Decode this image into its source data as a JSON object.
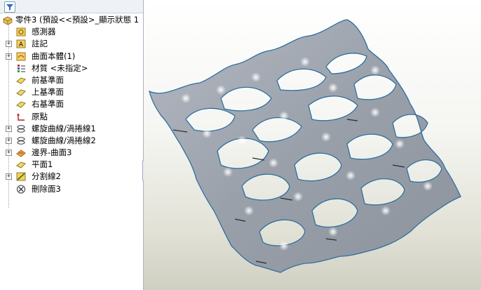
{
  "feature_tree": {
    "root_label": "零件3  (預設<<預設>_顯示狀態 1",
    "items": [
      {
        "label": "感測器",
        "icon": "sensor-icon",
        "expandable": false
      },
      {
        "label": "註記",
        "icon": "annotation-icon",
        "expandable": true
      },
      {
        "label": "曲面本體(1)",
        "icon": "surface-bodies-icon",
        "expandable": true
      },
      {
        "label": "材質 <未指定>",
        "icon": "material-icon",
        "expandable": false
      },
      {
        "label": "前基準面",
        "icon": "plane-icon",
        "expandable": false
      },
      {
        "label": "上基準面",
        "icon": "plane-icon",
        "expandable": false
      },
      {
        "label": "右基準面",
        "icon": "plane-icon",
        "expandable": false
      },
      {
        "label": "原點",
        "icon": "origin-icon",
        "expandable": false
      },
      {
        "label": "螺旋曲線/渦捲線1",
        "icon": "helix-icon",
        "expandable": true
      },
      {
        "label": "螺旋曲線/渦捲線2",
        "icon": "helix-icon",
        "expandable": true
      },
      {
        "label": "邊界-曲面3",
        "icon": "boundary-surface-icon",
        "expandable": true
      },
      {
        "label": "平面1",
        "icon": "plane-icon",
        "expandable": false
      },
      {
        "label": "分割線2",
        "icon": "split-line-icon",
        "expandable": true
      },
      {
        "label": "刪除面3",
        "icon": "delete-face-icon",
        "expandable": false
      }
    ]
  },
  "viewport": {
    "model_color": "#9aa0aa",
    "edge_color": "#2f6fa0",
    "background_top": "#ffffff",
    "background_bottom": "#cfcfc2"
  },
  "filter_icon": "filter-icon",
  "splitter_icon": "collapse-arrows-icon"
}
